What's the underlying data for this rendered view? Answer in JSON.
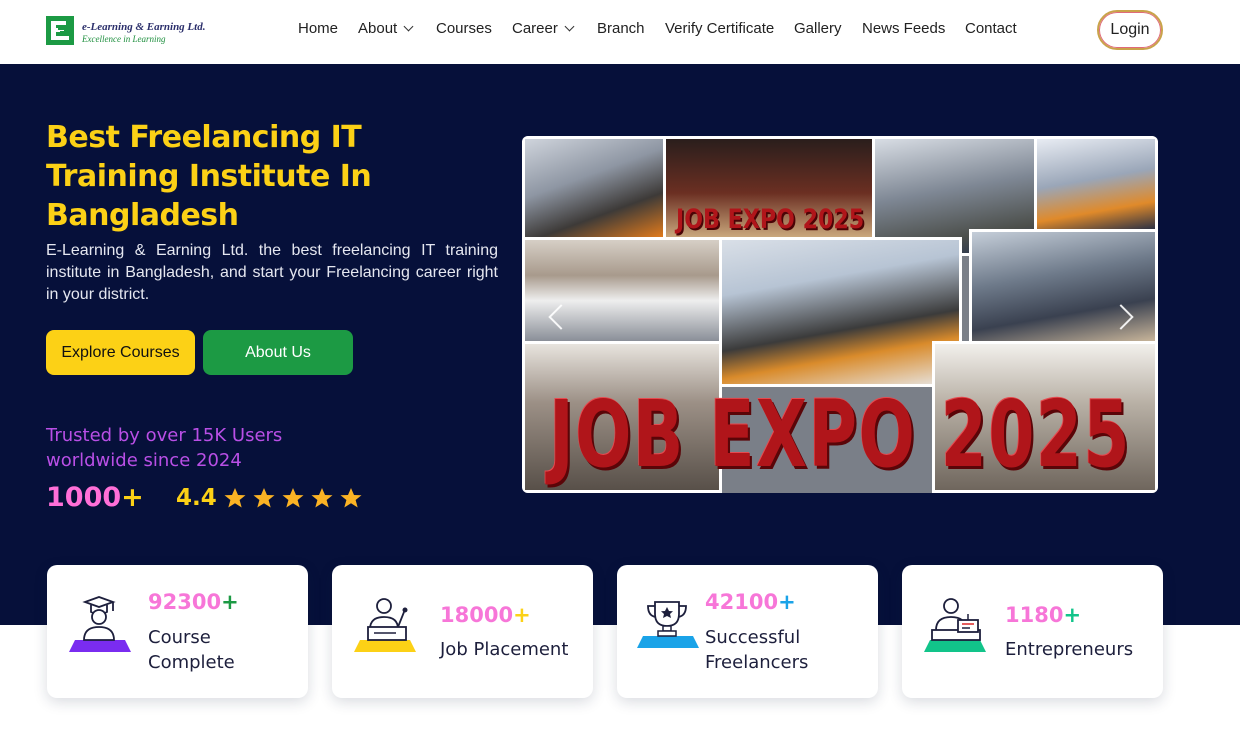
{
  "brand": {
    "name": "e-Learning & Earning Ltd.",
    "tagline": "Excellence in Learning",
    "colors": {
      "primary": "#1c9a44",
      "accent": "#fcd116",
      "hero_bg": "#06103a",
      "pink": "#f776d8"
    }
  },
  "nav": {
    "items": [
      {
        "label": "Home",
        "dropdown": false
      },
      {
        "label": "About",
        "dropdown": true
      },
      {
        "label": "Courses",
        "dropdown": false
      },
      {
        "label": "Career",
        "dropdown": true
      },
      {
        "label": "Branch",
        "dropdown": false
      },
      {
        "label": "Verify Certificate",
        "dropdown": false
      },
      {
        "label": "Gallery",
        "dropdown": false
      },
      {
        "label": "News Feeds",
        "dropdown": false
      },
      {
        "label": "Contact",
        "dropdown": false
      }
    ],
    "login_label": "Login"
  },
  "hero": {
    "title": "Best Freelancing IT Training Institute In Bangladesh",
    "description": "E-Learning & Earning Ltd. the best freelancing IT training institute in Bangladesh, and start your Freelancing career right in your district.",
    "explore_label": "Explore Courses",
    "about_label": "About Us",
    "trust_text": "Trusted by over 15K Users worldwide since 2024",
    "users_value": "1000",
    "users_suffix": "+",
    "rating": "4.4",
    "stars": 5,
    "carousel": {
      "banner_text": "JOB EXPO 2025",
      "small_banner_text": "JOB EXPO 2025",
      "icons": [
        "chevron-left-icon",
        "chevron-right-icon"
      ]
    }
  },
  "stats": [
    {
      "value": "92300",
      "suffix": "+",
      "suffix_color": "#1c9a44",
      "label": "Course Complete",
      "icon": "graduate-icon",
      "icon_color": "#7a2cf0"
    },
    {
      "value": "18000",
      "suffix": "+",
      "suffix_color": "#fcd116",
      "label": "Job Placement",
      "icon": "speaker-podium-icon",
      "icon_color": "#fcd116"
    },
    {
      "value": "42100",
      "suffix": "+",
      "suffix_color": "#1aa3e8",
      "label": "Successful Freelancers",
      "icon": "trophy-icon",
      "icon_color": "#1aa3e8"
    },
    {
      "value": "1180",
      "suffix": "+",
      "suffix_color": "#12c48a",
      "label": "Entrepreneurs",
      "icon": "entrepreneur-desk-icon",
      "icon_color": "#12c48a"
    }
  ]
}
